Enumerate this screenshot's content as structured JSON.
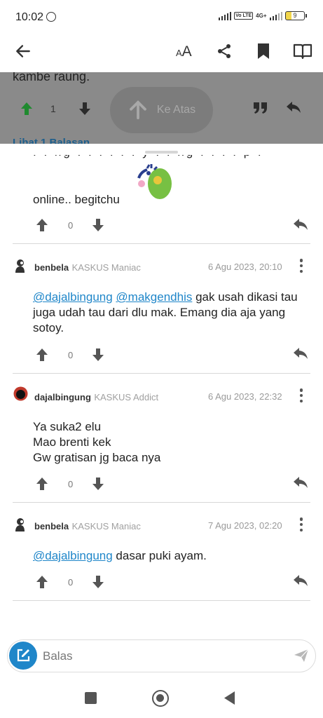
{
  "status_bar": {
    "time": "10:02",
    "network": "4G+",
    "volte": "Vo LTE",
    "battery": "9"
  },
  "toolbar": {
    "back_icon": "arrow-left-icon",
    "font_size_label": "AA",
    "share_icon": "share-icon",
    "bookmark_icon": "bookmark-icon",
    "read_icon": "open-book-icon"
  },
  "background_thread": {
    "partial_text": "kambe raung.",
    "upvote_count": "1",
    "view_replies": "Lihat 1 Balasan",
    "scroll_top_label": "Ke Atas"
  },
  "colors": {
    "accent": "#1f86c9",
    "mention": "#1f86c9",
    "upvote_active": "#1f8a2f"
  },
  "comments": [
    {
      "partial": true,
      "text": "online.. begitchu",
      "votes": "0"
    },
    {
      "username": "benbela",
      "rank": "KASKUS Maniac",
      "date": "6 Agu 2023, 20:10",
      "mention_1": "@dajalbingung",
      "mention_2": "@makgendhis",
      "text": " gak usah dikasi tau juga udah tau dari dlu mak. Emang dia aja yang sotoy.",
      "votes": "0"
    },
    {
      "username": "dajalbingung",
      "rank": "KASKUS Addict",
      "date": "6 Agu 2023, 22:32",
      "line_1": "Ya suka2 elu",
      "line_2": "Mao brenti kek",
      "line_3": "Gw gratisan jg baca nya",
      "votes": "0"
    },
    {
      "username": "benbela",
      "rank": "KASKUS Maniac",
      "date": "7 Agu 2023, 02:20",
      "mention_1": "@dajalbingung",
      "text": " dasar puki ayam.",
      "votes": "0"
    }
  ],
  "reply_bar": {
    "placeholder": "Balas"
  }
}
